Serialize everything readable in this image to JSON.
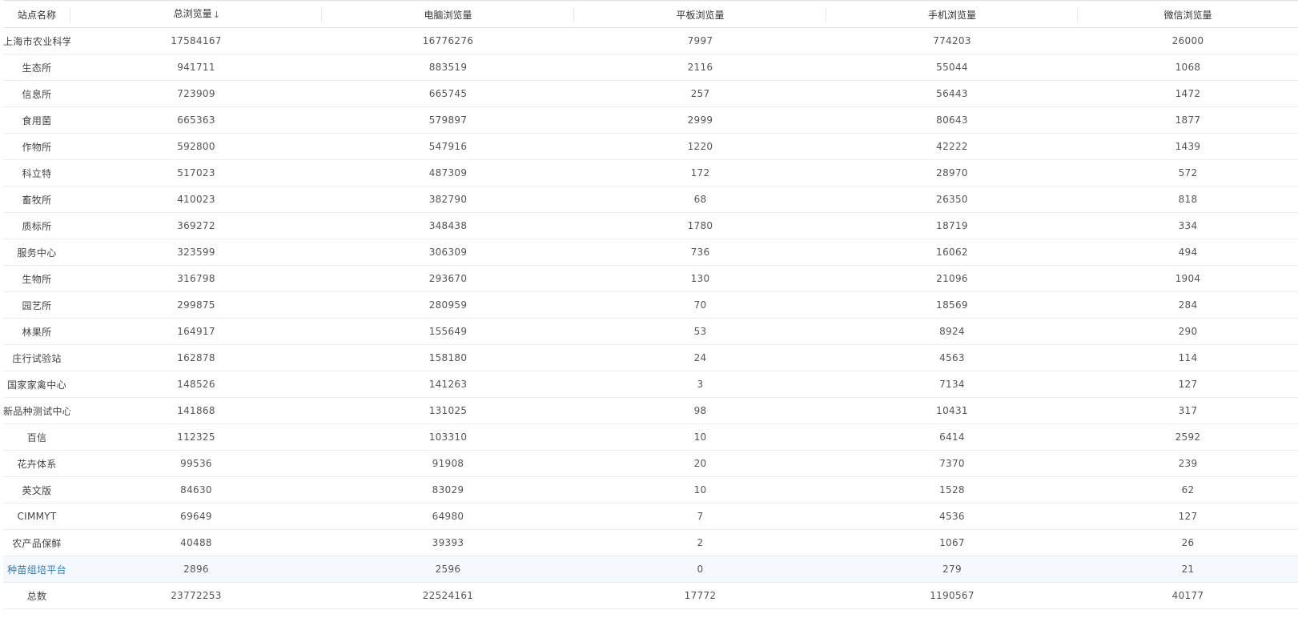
{
  "table": {
    "columns": [
      {
        "key": "name",
        "label": "站点名称",
        "sorted": false
      },
      {
        "key": "total",
        "label": "总浏览量",
        "sorted": true,
        "sort_icon": "arrow-down-icon",
        "sort_glyph": "🡓"
      },
      {
        "key": "pc",
        "label": "电脑浏览量",
        "sorted": false
      },
      {
        "key": "tablet",
        "label": "平板浏览量",
        "sorted": false
      },
      {
        "key": "mobile",
        "label": "手机浏览量",
        "sorted": false
      },
      {
        "key": "wechat",
        "label": "微信浏览量",
        "sorted": false
      }
    ],
    "rows": [
      {
        "name": "上海市农业科学",
        "total": "17584167",
        "pc": "16776276",
        "tablet": "7997",
        "mobile": "774203",
        "wechat": "26000"
      },
      {
        "name": "生态所",
        "total": "941711",
        "pc": "883519",
        "tablet": "2116",
        "mobile": "55044",
        "wechat": "1068"
      },
      {
        "name": "信息所",
        "total": "723909",
        "pc": "665745",
        "tablet": "257",
        "mobile": "56443",
        "wechat": "1472"
      },
      {
        "name": "食用菌",
        "total": "665363",
        "pc": "579897",
        "tablet": "2999",
        "mobile": "80643",
        "wechat": "1877"
      },
      {
        "name": "作物所",
        "total": "592800",
        "pc": "547916",
        "tablet": "1220",
        "mobile": "42222",
        "wechat": "1439"
      },
      {
        "name": "科立特",
        "total": "517023",
        "pc": "487309",
        "tablet": "172",
        "mobile": "28970",
        "wechat": "572"
      },
      {
        "name": "畜牧所",
        "total": "410023",
        "pc": "382790",
        "tablet": "68",
        "mobile": "26350",
        "wechat": "818"
      },
      {
        "name": "质标所",
        "total": "369272",
        "pc": "348438",
        "tablet": "1780",
        "mobile": "18719",
        "wechat": "334"
      },
      {
        "name": "服务中心",
        "total": "323599",
        "pc": "306309",
        "tablet": "736",
        "mobile": "16062",
        "wechat": "494"
      },
      {
        "name": "生物所",
        "total": "316798",
        "pc": "293670",
        "tablet": "130",
        "mobile": "21096",
        "wechat": "1904"
      },
      {
        "name": "园艺所",
        "total": "299875",
        "pc": "280959",
        "tablet": "70",
        "mobile": "18569",
        "wechat": "284"
      },
      {
        "name": "林果所",
        "total": "164917",
        "pc": "155649",
        "tablet": "53",
        "mobile": "8924",
        "wechat": "290"
      },
      {
        "name": "庄行试验站",
        "total": "162878",
        "pc": "158180",
        "tablet": "24",
        "mobile": "4563",
        "wechat": "114"
      },
      {
        "name": "国家家禽中心",
        "total": "148526",
        "pc": "141263",
        "tablet": "3",
        "mobile": "7134",
        "wechat": "127"
      },
      {
        "name": "新品种测试中心",
        "total": "141868",
        "pc": "131025",
        "tablet": "98",
        "mobile": "10431",
        "wechat": "317"
      },
      {
        "name": "百信",
        "total": "112325",
        "pc": "103310",
        "tablet": "10",
        "mobile": "6414",
        "wechat": "2592"
      },
      {
        "name": "花卉体系",
        "total": "99536",
        "pc": "91908",
        "tablet": "20",
        "mobile": "7370",
        "wechat": "239"
      },
      {
        "name": "英文版",
        "total": "84630",
        "pc": "83029",
        "tablet": "10",
        "mobile": "1528",
        "wechat": "62"
      },
      {
        "name": "CIMMYT",
        "total": "69649",
        "pc": "64980",
        "tablet": "7",
        "mobile": "4536",
        "wechat": "127"
      },
      {
        "name": "农产品保鲜",
        "total": "40488",
        "pc": "39393",
        "tablet": "2",
        "mobile": "1067",
        "wechat": "26"
      },
      {
        "name": "种苗组培平台",
        "total": "2896",
        "pc": "2596",
        "tablet": "0",
        "mobile": "279",
        "wechat": "21",
        "highlighted": true
      },
      {
        "name": "总数",
        "total": "23772253",
        "pc": "22524161",
        "tablet": "17772",
        "mobile": "1190567",
        "wechat": "40177"
      }
    ]
  },
  "colors": {
    "highlight_text": "#2a7ab8",
    "highlight_bg": "#f5f9fd",
    "row_border": "#ececec",
    "text": "#555555"
  }
}
